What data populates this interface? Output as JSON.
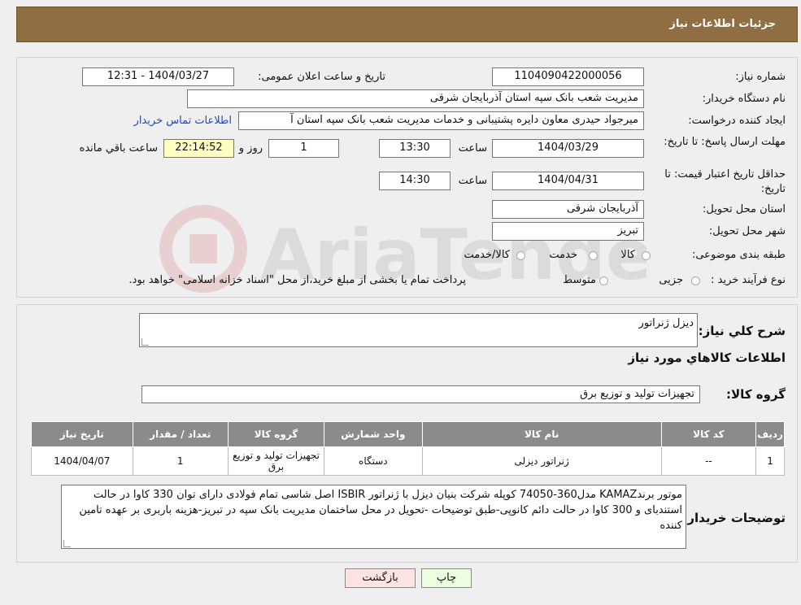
{
  "page_title": "جزئیات اطلاعات نیاز",
  "fields": {
    "need_number_label": "شماره نیاز:",
    "need_number": "1104090422000056",
    "announce_label": "تاریخ و ساعت اعلان عمومی:",
    "announce_value": "1404/03/27 - 12:31",
    "buyer_org_label": "نام دستگاه خریدار:",
    "buyer_org": "مدیریت شعب بانک سپه استان آذربایجان شرقی",
    "requester_label": "ایجاد کننده درخواست:",
    "requester": "میرجواد حیدری معاون دایره پشتیبانی و خدمات مدیریت شعب بانک سپه استان آ",
    "contact_link": "اطلاعات تماس خریدار",
    "deadline_label": "مهلت ارسال پاسخ: تا تاریخ:",
    "deadline_date": "1404/03/29",
    "time_word": "ساعت",
    "deadline_time": "13:30",
    "days_value": "1",
    "days_word": "روز و",
    "remaining_time": "22:14:52",
    "remaining_word": "ساعت باقي مانده",
    "validity_label": "حداقل تاریخ اعتبار قیمت: تا تاریخ:",
    "validity_date": "1404/04/31",
    "validity_time": "14:30",
    "province_label": "استان محل تحویل:",
    "province": "آذربایجان شرقی",
    "city_label": "شهر محل تحویل:",
    "city": "تبریز",
    "category_label": "طبقه بندی موضوعی:",
    "category_options": [
      "کالا",
      "خدمت",
      "کالا/خدمت"
    ],
    "purchase_label": "نوع فرآیند خرید :",
    "purchase_options": [
      "جزیی",
      "متوسط"
    ],
    "purchase_note": "پرداخت تمام یا بخشی از مبلغ خرید،از محل \"اسناد خزانه اسلامی\" خواهد بود."
  },
  "summary": {
    "desc_label": "شرح کلي نياز:",
    "desc_value": "دیزل ژنراتور",
    "items_title": "اطلاعات کالاهاي مورد نياز",
    "group_label": "گروه کالا:",
    "group_value": "تجهیزات تولید و توزیع برق"
  },
  "table": {
    "headers": [
      "رديف",
      "کد کالا",
      "نام کالا",
      "واحد شمارش",
      "گروه کالا",
      "تعداد / مقدار",
      "تاریخ نیاز"
    ],
    "row": {
      "index": "1",
      "code": "--",
      "name": "ژنراتور دیزلی",
      "unit": "دستگاه",
      "group": "تجهیزات تولید و توزیع برق",
      "qty": "1",
      "date": "1404/04/07"
    }
  },
  "buyer_notes": {
    "label": "توضیحات خریدار:",
    "text": "موتور برندKAMAZ مدل360-74050 کوپله شرکت بنیان دیزل با ژنراتور ISBIR اصل شاسی تمام فولادی دارای توان 330 کاوا در حالت استندبای و 300 کاوا در حالت دائم کانوپی-طبق توضیحات -تحویل در محل ساختمان مدیریت بانک سپه در تبریز-هزینه باربری بر عهده تامین کننده"
  },
  "buttons": {
    "print": "چاپ",
    "back": "بازگشت"
  },
  "colors": {
    "header_bg": "#8f6e43",
    "table_header_bg": "#8b8b8b",
    "link": "#1f48c9",
    "print_bg": "#ecffe0",
    "back_bg": "#ffe2e2"
  }
}
